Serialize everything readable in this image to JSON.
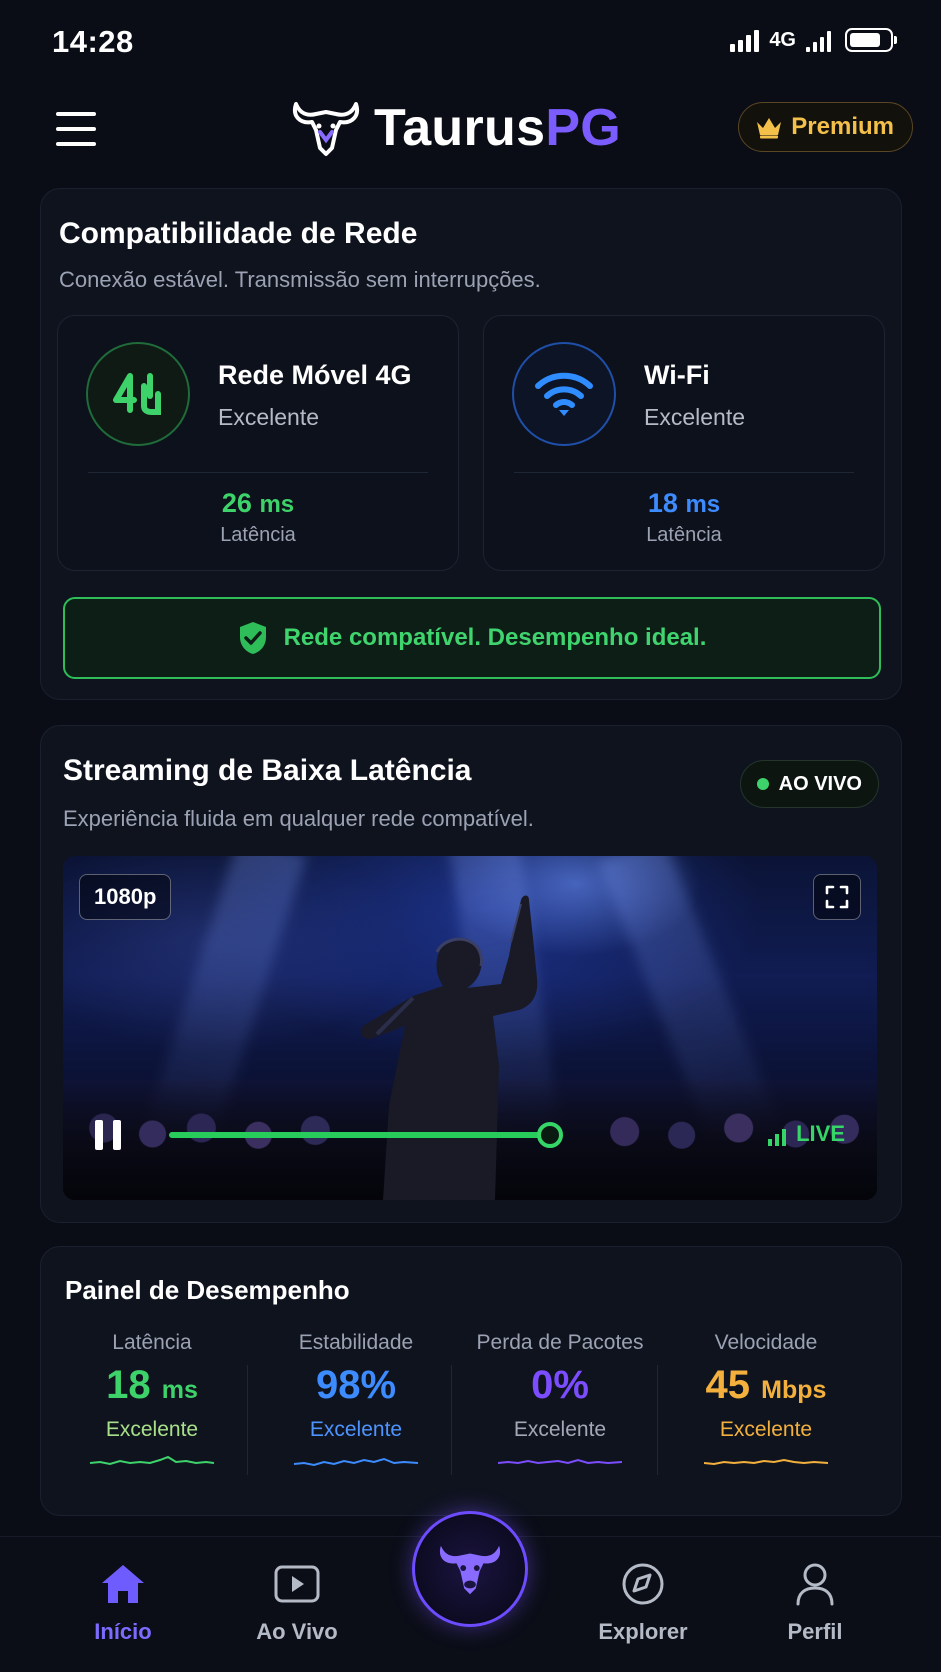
{
  "status_bar": {
    "time": "14:28",
    "network": "4G"
  },
  "header": {
    "brand_part1": "Taurus",
    "brand_part2": "PG",
    "premium_label": "Premium"
  },
  "network_card": {
    "title": "Compatibilidade de Rede",
    "subtitle": "Conexão estável. Transmissão sem interrupções.",
    "tiles": [
      {
        "name": "Rede Móvel 4G",
        "status": "Excelente",
        "value": "26",
        "unit": "ms",
        "metric_label": "Latência",
        "icon": "4g-icon",
        "color": "#3ed36a"
      },
      {
        "name": "Wi-Fi",
        "status": "Excelente",
        "value": "18",
        "unit": "ms",
        "metric_label": "Latência",
        "icon": "wifi-icon",
        "color": "#3d8cff"
      }
    ],
    "banner_text": "Rede compatível. Desempenho ideal."
  },
  "stream_card": {
    "title": "Streaming de Baixa Latência",
    "subtitle": "Experiência fluida em qualquer rede compatível.",
    "live_pill": "AO VIVO",
    "resolution": "1080p",
    "live_tag": "LIVE",
    "progress": 0.82
  },
  "performance": {
    "title": "Painel de Desempenho",
    "metrics": [
      {
        "label": "Latência",
        "value": "18",
        "unit": "ms",
        "status": "Excelente",
        "color": "#3ed36a",
        "status_color": "#a8e08a"
      },
      {
        "label": "Estabilidade",
        "value": "98%",
        "unit": "",
        "status": "Excelente",
        "color": "#3d8cff",
        "status_color": "#4d94ff"
      },
      {
        "label": "Perda de Pacotes",
        "value": "0%",
        "unit": "",
        "status": "Excelente",
        "color": "#7b4dff",
        "status_color": "#a2a8b8"
      },
      {
        "label": "Velocidade",
        "value": "45",
        "unit": "Mbps",
        "status": "Excelente",
        "color": "#f3b03d",
        "status_color": "#f3b03d"
      }
    ]
  },
  "bottom_nav": {
    "items": [
      {
        "label": "Início",
        "icon": "home-icon",
        "active": true
      },
      {
        "label": "Ao Vivo",
        "icon": "play-icon",
        "active": false
      },
      {
        "label": "Explorer",
        "icon": "compass-icon",
        "active": false
      },
      {
        "label": "Perfil",
        "icon": "user-icon",
        "active": false
      }
    ]
  }
}
